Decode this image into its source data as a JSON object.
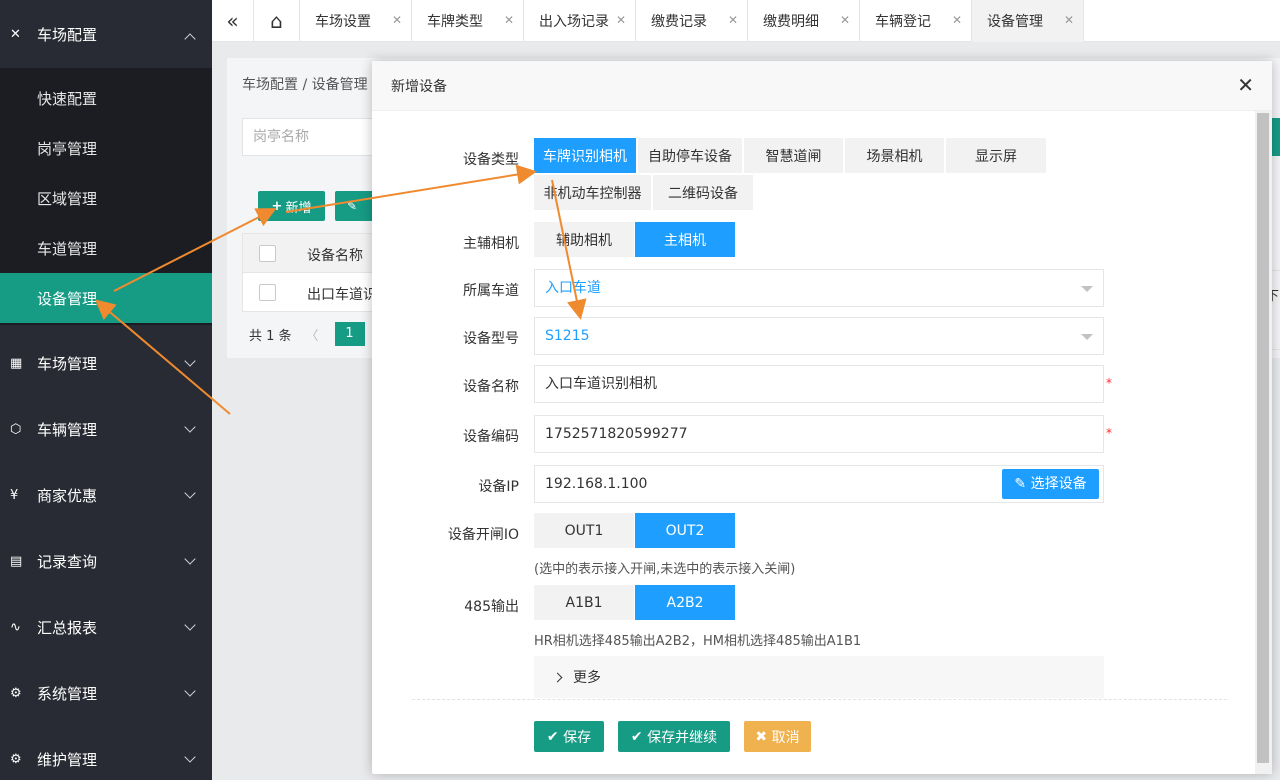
{
  "sidebar": {
    "header": {
      "label": "车场配置"
    },
    "sub_items": [
      {
        "label": "快速配置"
      },
      {
        "label": "岗亭管理"
      },
      {
        "label": "区域管理"
      },
      {
        "label": "车道管理"
      },
      {
        "label": "设备管理",
        "active": true
      }
    ],
    "groups": [
      {
        "label": "车场管理",
        "icon": "grid-icon"
      },
      {
        "label": "车辆管理",
        "icon": "cube-icon"
      },
      {
        "label": "商家优惠",
        "icon": "yen-icon"
      },
      {
        "label": "记录查询",
        "icon": "doc-icon"
      },
      {
        "label": "汇总报表",
        "icon": "pulse-icon"
      },
      {
        "label": "系统管理",
        "icon": "gear-icon"
      },
      {
        "label": "维护管理",
        "icon": "gear-icon"
      }
    ]
  },
  "tabbar": {
    "collapse_glyph": "«",
    "home_glyph": "⌂",
    "tabs": [
      {
        "label": "车场设置"
      },
      {
        "label": "车牌类型"
      },
      {
        "label": "出入场记录"
      },
      {
        "label": "缴费记录"
      },
      {
        "label": "缴费明细"
      },
      {
        "label": "车辆登记"
      },
      {
        "label": "设备管理",
        "active": true
      }
    ],
    "close_glyph": "✕"
  },
  "background_page": {
    "breadcrumb": "车场配置  /  设备管理",
    "search_placeholder": "岗亭名称",
    "add_button": "新增",
    "column_header": "设备名称",
    "row_text": "出口车道识",
    "total": "共 1 条",
    "page": "1",
    "right_cell": "下"
  },
  "modal": {
    "title": "新增设备",
    "close_glyph": "✕",
    "device_type": {
      "label": "设备类型",
      "options": [
        "车牌识别相机",
        "自助停车设备",
        "智慧道闸",
        "场景相机",
        "显示屏",
        "非机动车控制器",
        "二维码设备"
      ],
      "selected": "车牌识别相机"
    },
    "camera_role": {
      "label": "主辅相机",
      "options": [
        "辅助相机",
        "主相机"
      ],
      "selected": "主相机"
    },
    "lane": {
      "label": "所属车道",
      "value": "入口车道"
    },
    "model": {
      "label": "设备型号",
      "value": "S1215"
    },
    "name": {
      "label": "设备名称",
      "value": "入口车道识别相机"
    },
    "code": {
      "label": "设备编码",
      "value": "1752571820599277"
    },
    "ip": {
      "label": "设备IP",
      "value": "192.168.1.100",
      "pick_button": "选择设备"
    },
    "io": {
      "label": "设备开闸IO",
      "options": [
        "OUT1",
        "OUT2"
      ],
      "selected": "OUT2",
      "hint": "(选中的表示接入开闸,未选中的表示接入关闸)"
    },
    "rs485": {
      "label": "485输出",
      "options": [
        "A1B1",
        "A2B2"
      ],
      "selected": "A2B2",
      "hint": "HR相机选择485输出A2B2，HM相机选择485输出A1B1"
    },
    "more": "更多",
    "required_mark": "*",
    "buttons": {
      "save": "保存",
      "save_continue": "保存并继续",
      "cancel": "取消"
    }
  },
  "colors": {
    "sidebar_bg": "#282b33",
    "submenu_bg": "#1b1d23",
    "accent_green": "#169b85",
    "accent_blue": "#1e9fff",
    "cancel_orange": "#f0b14f",
    "annotation_arrow": "#f08a2e"
  }
}
